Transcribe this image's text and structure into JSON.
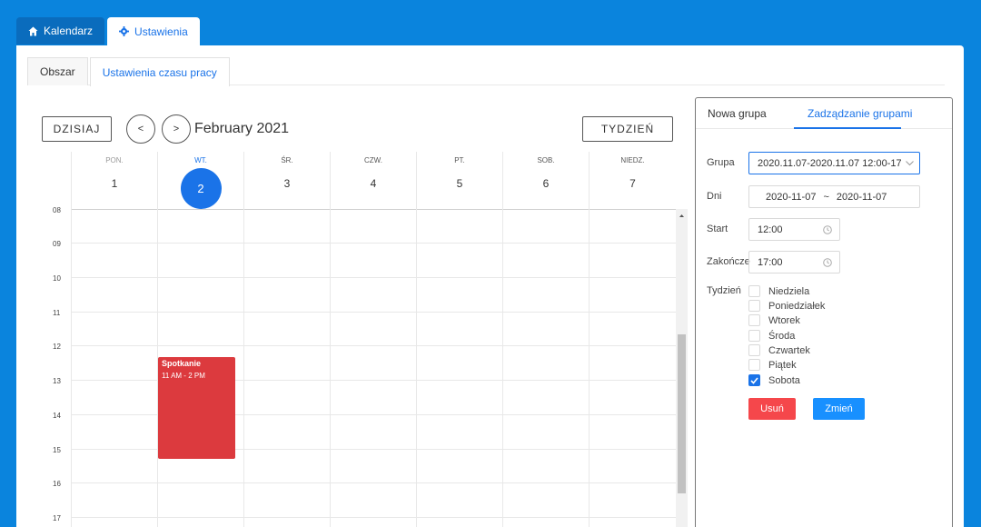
{
  "top_tabs": [
    {
      "label": "Kalendarz",
      "icon": "home-icon"
    },
    {
      "label": "Ustawienia",
      "icon": "gear-icon"
    }
  ],
  "sub_tabs": [
    "Obszar",
    "Ustawienia czasu pracy"
  ],
  "toolbar": {
    "today_label": "DZISIAJ",
    "prev_label": "<",
    "next_label": ">",
    "month_title": "February 2021",
    "view_label": "TYDZIEŃ"
  },
  "days": [
    {
      "name": "PON.",
      "num": "1"
    },
    {
      "name": "WT.",
      "num": "2"
    },
    {
      "name": "ŚR.",
      "num": "3"
    },
    {
      "name": "CZW.",
      "num": "4"
    },
    {
      "name": "PT.",
      "num": "5"
    },
    {
      "name": "SOB.",
      "num": "6"
    },
    {
      "name": "NIEDZ.",
      "num": "7"
    }
  ],
  "hours": [
    "08",
    "09",
    "10",
    "11",
    "12",
    "13",
    "14",
    "15",
    "16",
    "17"
  ],
  "event": {
    "title": "Spotkanie",
    "time": "11 AM - 2 PM",
    "color": "#dc3a3e"
  },
  "side": {
    "tabs": [
      "Nowa grupa",
      "Zadządzanie grupami"
    ],
    "group_label": "Grupa",
    "group_value": "2020.11.07-2020.11.07 12:00-17",
    "days_label": "Dni",
    "days_from": "2020-11-07",
    "days_sep": "~",
    "days_to": "2020-11-07",
    "start_label": "Start",
    "start_value": "12:00",
    "end_label": "Zakończe",
    "end_value": "17:00",
    "week_label": "Tydzień",
    "weekdays": [
      {
        "label": "Niedziela",
        "checked": false
      },
      {
        "label": "Poniedziałek",
        "checked": false
      },
      {
        "label": "Wtorek",
        "checked": false
      },
      {
        "label": "Środa",
        "checked": false
      },
      {
        "label": "Czwartek",
        "checked": false
      },
      {
        "label": "Piątek",
        "checked": false
      },
      {
        "label": "Sobota",
        "checked": true
      }
    ],
    "delete_label": "Usuń",
    "change_label": "Zmień"
  },
  "colors": {
    "background": "#0a84dd",
    "accent": "#1a73e8",
    "danger": "#f5474b"
  }
}
